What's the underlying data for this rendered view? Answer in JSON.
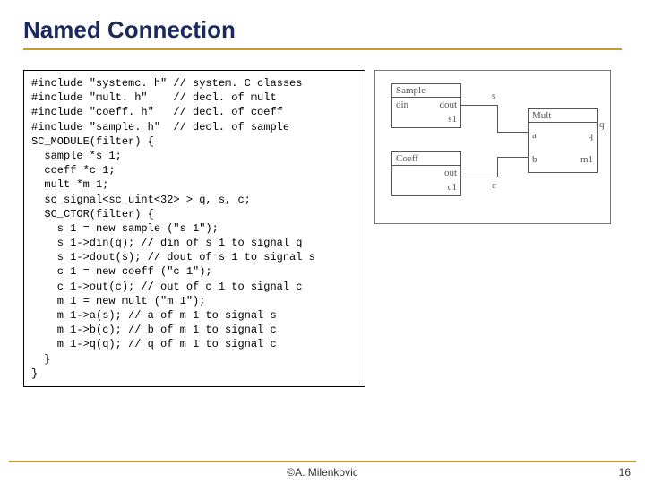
{
  "title": "Named Connection",
  "code": "#include \"systemc. h\" // system. C classes\n#include \"mult. h\"    // decl. of mult\n#include \"coeff. h\"   // decl. of coeff\n#include \"sample. h\"  // decl. of sample\nSC_MODULE(filter) {\n  sample *s 1;\n  coeff *c 1;\n  mult *m 1;\n  sc_signal<sc_uint<32> > q, s, c;\n  SC_CTOR(filter) {\n    s 1 = new sample (\"s 1\");\n    s 1->din(q); // din of s 1 to signal q\n    s 1->dout(s); // dout of s 1 to signal s\n    c 1 = new coeff (\"c 1\");\n    c 1->out(c); // out of c 1 to signal c\n    m 1 = new mult (\"m 1\");\n    m 1->a(s); // a of m 1 to signal s\n    m 1->b(c); // b of m 1 to signal c\n    m 1->q(q); // q of m 1 to signal c\n  }\n}",
  "diagram": {
    "sample": {
      "title": "Sample",
      "ports": {
        "din": "din",
        "dout": "dout"
      },
      "inst": "s1"
    },
    "coeff": {
      "title": "Coeff",
      "ports": {
        "out": "out"
      },
      "inst": "c1"
    },
    "mult": {
      "title": "Mult",
      "ports": {
        "a": "a",
        "b": "b",
        "q": "q"
      },
      "inst": "m1"
    },
    "signals": {
      "s": "s",
      "c": "c",
      "q": "q"
    }
  },
  "footer": {
    "author": "©A. Milenkovic",
    "page": "16"
  },
  "chart_data": {
    "type": "diagram",
    "title": "Named Connection block diagram",
    "modules": [
      {
        "name": "Sample",
        "instance": "s1",
        "ports": [
          "din",
          "dout"
        ]
      },
      {
        "name": "Coeff",
        "instance": "c1",
        "ports": [
          "out"
        ]
      },
      {
        "name": "Mult",
        "instance": "m1",
        "ports": [
          "a",
          "b",
          "q"
        ]
      }
    ],
    "signals": [
      "s",
      "c",
      "q"
    ],
    "connections": [
      {
        "from": "s1.dout",
        "to": "m1.a",
        "signal": "s"
      },
      {
        "from": "c1.out",
        "to": "m1.b",
        "signal": "c"
      },
      {
        "from": "m1.q",
        "to": "s1.din",
        "signal": "q"
      }
    ]
  }
}
